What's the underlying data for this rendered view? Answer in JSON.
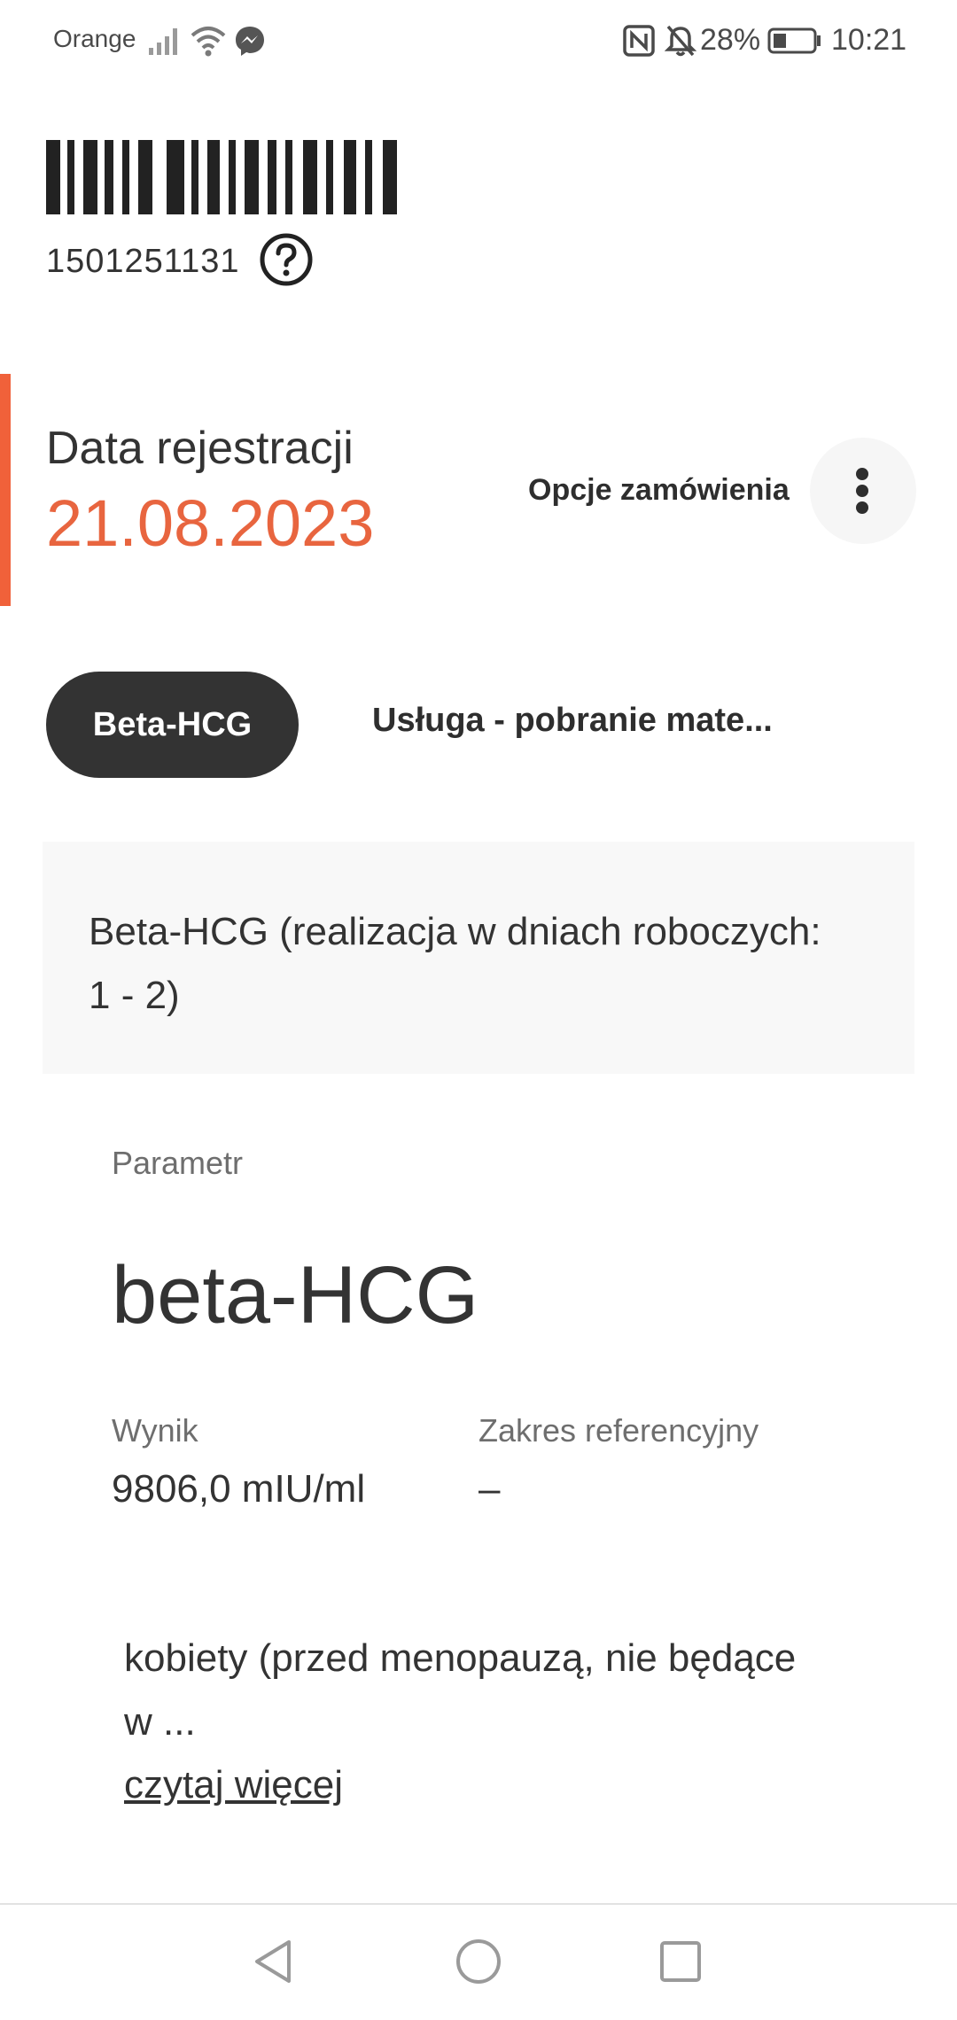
{
  "status_bar": {
    "carrier": "Orange",
    "battery": "28%",
    "time": "10:21",
    "icons": [
      "signal-icon",
      "wifi-icon",
      "messenger-icon",
      "nfc-icon",
      "muted-bell-icon",
      "battery-icon"
    ]
  },
  "order": {
    "barcode_number": "1501251131",
    "registration_label": "Data rejestracji",
    "registration_date": "21.08.2023",
    "options_label": "Opcje zamówienia"
  },
  "tabs": [
    {
      "label": "Beta-HCG",
      "active": true
    },
    {
      "label": "Usługa - pobranie mate...",
      "active": false
    }
  ],
  "description": "Beta-HCG (realizacja w dniach roboczych: 1 - 2)",
  "parameter": {
    "label": "Parametr",
    "name": "beta-HCG",
    "result_label": "Wynik",
    "result_value": "9806,0 mIU/ml",
    "reference_label": "Zakres referencyjny",
    "reference_value": "–"
  },
  "note": {
    "text": "kobiety (przed menopauzą, nie będące w ...",
    "read_more": "czytaj więcej"
  },
  "colors": {
    "accent": "#e8653f",
    "tab_active_bg": "#333333",
    "card_bg": "#f8f8f8"
  }
}
